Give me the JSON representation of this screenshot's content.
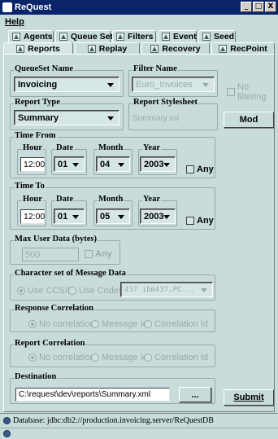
{
  "window": {
    "title": "ReQuest",
    "minimize": "_",
    "maximize": "□",
    "close": "X"
  },
  "menu": {
    "help": "Help"
  },
  "tabs_back": [
    "Agents",
    "Queue Sets",
    "Filters",
    "Event",
    "Seed"
  ],
  "tabs_front": [
    "Reports",
    "Replay",
    "Recovery",
    "RecPoint"
  ],
  "queueset": {
    "label": "QueueSet Name",
    "value": "Invoicing"
  },
  "filter": {
    "label": "Filter Name",
    "value": "Euro_Invoices",
    "no_filtering": "No filtering"
  },
  "report_type": {
    "label": "Report Type",
    "value": "Summary"
  },
  "stylesheet": {
    "label": "Report Stylesheet",
    "value": "Summary.xsl",
    "mod_button": "Mod"
  },
  "time_from": {
    "label": "Time From",
    "hour_label": "Hour",
    "hour": "12:00",
    "date_label": "Date",
    "date": "01",
    "month_label": "Month",
    "month": "04",
    "year_label": "Year",
    "year": "2003",
    "any": "Any"
  },
  "time_to": {
    "label": "Time To",
    "hour_label": "Hour",
    "hour": "12:00",
    "date_label": "Date",
    "date": "01",
    "month_label": "Month",
    "month": "05",
    "year_label": "Year",
    "year": "2003",
    "any": "Any"
  },
  "max_user": {
    "label": "Max User Data (bytes)",
    "value": "500",
    "any": "Any"
  },
  "charset": {
    "label": "Character set of Message Data",
    "use_ccsid": "Use CCSID",
    "use_codeset": "Use Codeset",
    "codeset_value": "437   ibm437,PC..."
  },
  "response_corr": {
    "label": "Response Correlation",
    "options": [
      "No correlation",
      "Message Id",
      "Correlation Id"
    ]
  },
  "report_corr": {
    "label": "Report Correlation",
    "options": [
      "No correlation",
      "Message Id",
      "Correlation Id"
    ]
  },
  "destination": {
    "label": "Destination",
    "value": "C:\\request\\dev\\reports\\Summary.xml",
    "browse": "..."
  },
  "submit": "Submit",
  "status": "Database: jdbc:db2://production.invoicing.server/ReQuestDB"
}
